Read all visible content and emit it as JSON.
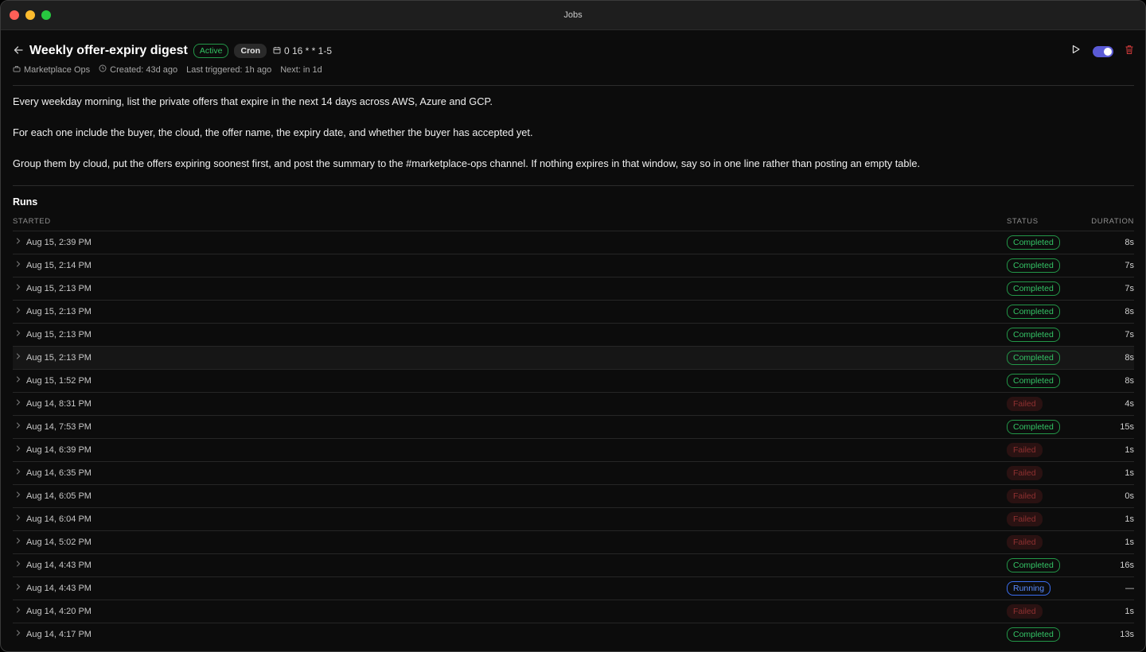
{
  "window": {
    "title": "Jobs"
  },
  "job": {
    "title": "Weekly offer-expiry digest",
    "state_badge": "Active",
    "trigger_badge": "Cron",
    "cron_expression": "0 16 * * 1-5",
    "meta": {
      "owner": "Marketplace Ops",
      "created": "Created: 43d ago",
      "last_triggered": "Last triggered: 1h ago",
      "next": "Next: in 1d"
    },
    "enabled": true,
    "description": [
      "Every weekday morning, list the private offers that expire in the next 14 days across AWS, Azure and GCP.",
      "For each one include the buyer, the cloud, the offer name, the expiry date, and whether the buyer has accepted yet.",
      "Group them by cloud, put the offers expiring soonest first, and post the summary to the #marketplace-ops channel. If nothing expires in that window, say so in one line rather than posting an empty table."
    ]
  },
  "runs": {
    "title": "Runs",
    "columns": {
      "started": "STARTED",
      "status": "STATUS",
      "duration": "DURATION"
    },
    "rows": [
      {
        "started": "Aug 15, 2:39 PM",
        "status": "Completed",
        "duration": "8s"
      },
      {
        "started": "Aug 15, 2:14 PM",
        "status": "Completed",
        "duration": "7s"
      },
      {
        "started": "Aug 15, 2:13 PM",
        "status": "Completed",
        "duration": "7s"
      },
      {
        "started": "Aug 15, 2:13 PM",
        "status": "Completed",
        "duration": "8s"
      },
      {
        "started": "Aug 15, 2:13 PM",
        "status": "Completed",
        "duration": "7s"
      },
      {
        "started": "Aug 15, 2:13 PM",
        "status": "Completed",
        "duration": "8s"
      },
      {
        "started": "Aug 15, 1:52 PM",
        "status": "Completed",
        "duration": "8s"
      },
      {
        "started": "Aug 14, 8:31 PM",
        "status": "Failed",
        "duration": "4s"
      },
      {
        "started": "Aug 14, 7:53 PM",
        "status": "Completed",
        "duration": "15s"
      },
      {
        "started": "Aug 14, 6:39 PM",
        "status": "Failed",
        "duration": "1s"
      },
      {
        "started": "Aug 14, 6:35 PM",
        "status": "Failed",
        "duration": "1s"
      },
      {
        "started": "Aug 14, 6:05 PM",
        "status": "Failed",
        "duration": "0s"
      },
      {
        "started": "Aug 14, 6:04 PM",
        "status": "Failed",
        "duration": "1s"
      },
      {
        "started": "Aug 14, 5:02 PM",
        "status": "Failed",
        "duration": "1s"
      },
      {
        "started": "Aug 14, 4:43 PM",
        "status": "Completed",
        "duration": "16s"
      },
      {
        "started": "Aug 14, 4:43 PM",
        "status": "Running",
        "duration": "—"
      },
      {
        "started": "Aug 14, 4:20 PM",
        "status": "Failed",
        "duration": "1s"
      },
      {
        "started": "Aug 14, 4:17 PM",
        "status": "Completed",
        "duration": "13s"
      }
    ]
  },
  "colors": {
    "completed": "#34c466",
    "failed": "#8e3030",
    "running": "#5a8cff",
    "toggle_on": "#5b5bd6",
    "delete": "#d03a3a"
  },
  "icons": {
    "back": "arrow-left-icon",
    "schedule": "calendar-icon",
    "owner": "team-icon",
    "created": "clock-icon",
    "run": "play-icon",
    "delete": "trash-icon",
    "expand": "chevron-right-icon"
  }
}
